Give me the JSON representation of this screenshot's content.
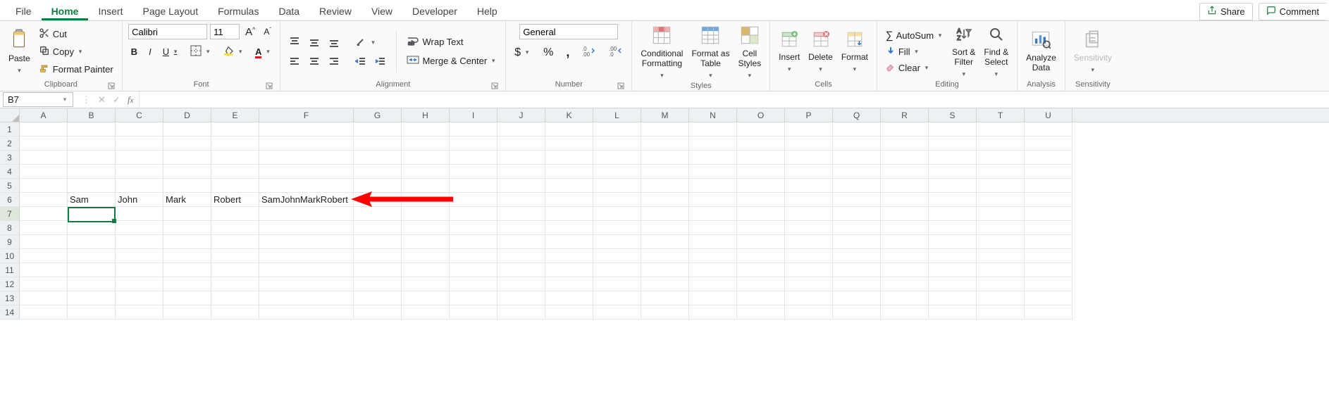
{
  "tabs": {
    "file": "File",
    "home": "Home",
    "insert": "Insert",
    "pagelayout": "Page Layout",
    "formulas": "Formulas",
    "data": "Data",
    "review": "Review",
    "view": "View",
    "developer": "Developer",
    "help": "Help"
  },
  "topright": {
    "share": "Share",
    "comment": "Comment"
  },
  "ribbon": {
    "clipboard": {
      "paste": "Paste",
      "cut": "Cut",
      "copy": "Copy",
      "painter": "Format Painter",
      "label": "Clipboard"
    },
    "font": {
      "name": "Calibri",
      "size": "11",
      "bold": "B",
      "italic": "I",
      "underline": "U",
      "label": "Font"
    },
    "alignment": {
      "wrap": "Wrap Text",
      "merge": "Merge & Center",
      "label": "Alignment"
    },
    "number": {
      "format": "General",
      "label": "Number"
    },
    "styles": {
      "cond": "Conditional\nFormatting",
      "table": "Format as\nTable",
      "cell": "Cell\nStyles",
      "label": "Styles"
    },
    "cells": {
      "insert": "Insert",
      "delete": "Delete",
      "format": "Format",
      "label": "Cells"
    },
    "editing": {
      "autosum": "AutoSum",
      "fill": "Fill",
      "clear": "Clear",
      "sort": "Sort &\nFilter",
      "find": "Find &\nSelect",
      "label": "Editing"
    },
    "analysis": {
      "analyze": "Analyze\nData",
      "label": "Analysis"
    },
    "sensitivity": {
      "sens": "Sensitivity",
      "label": "Sensitivity"
    }
  },
  "fbar": {
    "ref": "B7",
    "formula": ""
  },
  "columns": [
    "A",
    "B",
    "C",
    "D",
    "E",
    "F",
    "G",
    "H",
    "I",
    "J",
    "K",
    "L",
    "M",
    "N",
    "O",
    "P",
    "Q",
    "R",
    "S",
    "T",
    "U"
  ],
  "rows": [
    "1",
    "2",
    "3",
    "4",
    "5",
    "6",
    "7",
    "8",
    "9",
    "10",
    "11",
    "12",
    "13",
    "14"
  ],
  "cells": {
    "B6": "Sam",
    "C6": "John",
    "D6": "Mark",
    "E6": "Robert",
    "F6": "SamJohnMarkRobert"
  },
  "active_cell": "B7"
}
